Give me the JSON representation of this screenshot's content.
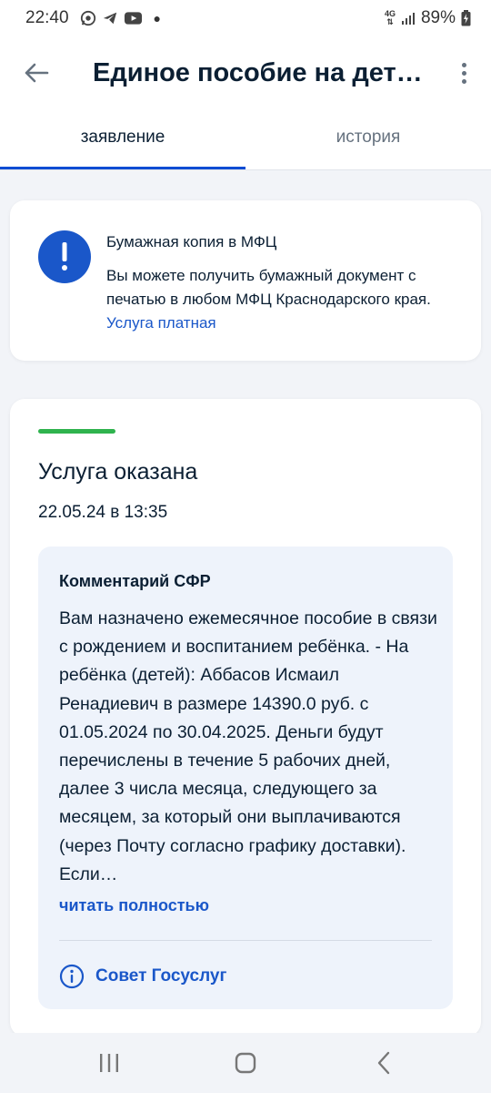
{
  "status_bar": {
    "time": "22:40",
    "network": "4G",
    "battery": "89%",
    "icons": [
      "whatsapp-icon",
      "telegram-icon",
      "youtube-icon"
    ]
  },
  "app_bar": {
    "title": "Единое пособие на дет…"
  },
  "tabs": [
    {
      "label": "заявление",
      "active": true
    },
    {
      "label": "история",
      "active": false
    }
  ],
  "mfc_card": {
    "title": "Бумажная копия в МФЦ",
    "text": "Вы можете получить бумажный документ с печатью в любом МФЦ Краснодарского края.",
    "link": "Услуга платная"
  },
  "status_card": {
    "status": "Услуга оказана",
    "date": "22.05.24 в 13:35",
    "comment": {
      "title": "Комментарий СФР",
      "text": "Вам назначено ежемесячное пособие в связи с рождением и воспитанием ребёнка. - На ребёнка (детей): Аббасов Исмаил Ренадиевич в размере 14390.0 руб. с 01.05.2024 по 30.04.2025. Деньги будут перечислены в течение 5 рабочих дней, далее 3 числа месяца, следующего за месяцем, за который они выплачиваются (через Почту согласно графику доставки). Если…",
      "read_more": "читать полностью",
      "advice": "Совет Госуслуг"
    }
  },
  "colors": {
    "accent": "#1a57c9",
    "tab_indicator": "#0d4cd3",
    "success": "#2fb34e",
    "comment_bg": "#eef3fb",
    "page_bg": "#f2f4f8"
  }
}
